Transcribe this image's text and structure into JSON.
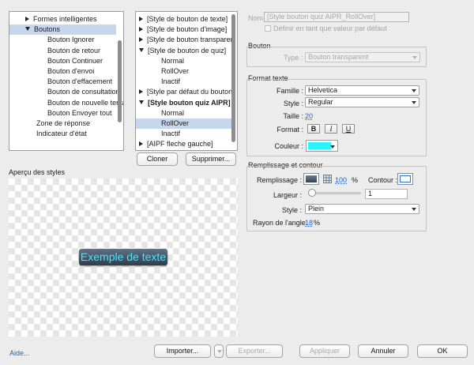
{
  "tree1": {
    "items": [
      {
        "label": "Formes intelligentes",
        "expander": "collapsed"
      },
      {
        "label": "Boutons",
        "expander": "expanded",
        "selected": true
      },
      {
        "label": "Bouton Ignorer"
      },
      {
        "label": "Bouton de retour"
      },
      {
        "label": "Bouton Continuer"
      },
      {
        "label": "Bouton d'envoi"
      },
      {
        "label": "Bouton d'effacement"
      },
      {
        "label": "Bouton de consultation"
      },
      {
        "label": "Bouton de nouvelle tentative"
      },
      {
        "label": "Bouton Envoyer tout"
      },
      {
        "label": "Zone de réponse"
      },
      {
        "label": "Indicateur d'état"
      }
    ]
  },
  "tree2": {
    "items": [
      {
        "label": "[Style de bouton de texte]",
        "expander": "collapsed"
      },
      {
        "label": "[Style de bouton d'image]",
        "expander": "collapsed"
      },
      {
        "label": "[Style de bouton transparent]",
        "expander": "collapsed"
      },
      {
        "label": "[Style de bouton de quiz]",
        "expander": "expanded"
      },
      {
        "label": "Normal"
      },
      {
        "label": "RollOver"
      },
      {
        "label": "Inactif"
      },
      {
        "label": "[Style par défaut du bouton]",
        "expander": "collapsed"
      },
      {
        "label": "[Style bouton quiz AIPR]",
        "expander": "expanded",
        "bold": true
      },
      {
        "label": "Normal"
      },
      {
        "label": "RollOver",
        "selected": true
      },
      {
        "label": "Inactif"
      },
      {
        "label": "[AIPF fleche gauche]",
        "expander": "collapsed"
      }
    ]
  },
  "buttons": {
    "clone": "Cloner",
    "delete": "Supprimer...",
    "help": "Aide...",
    "import": "Importer...",
    "export": "Exporter...",
    "apply": "Appliquer",
    "cancel": "Annuler",
    "ok": "OK"
  },
  "preview": {
    "label": "Aperçu des styles",
    "sample_text": "Exemple de texte"
  },
  "name": {
    "label": "Nom",
    "value": "[Style bouton quiz AIPR_RollOver]",
    "default_checkbox": "Définir en tant que valeur par défaut"
  },
  "button_group": {
    "title": "Bouton",
    "type_label": "Type :",
    "type_value": "Bouton transparent"
  },
  "text_format": {
    "title": "Format texte",
    "family_label": "Famille :",
    "family_value": "Helvetica",
    "style_label": "Style :",
    "style_value": "Regular",
    "size_label": "Taille :",
    "size_value": "20",
    "format_label": "Format :",
    "bold": "B",
    "italic": "I",
    "underline": "U",
    "color_label": "Couleur :",
    "color_value": "#29f4ff"
  },
  "fill_stroke": {
    "title": "Remplissage et contour",
    "fill_label": "Remplissage :",
    "fill_opacity": "100",
    "percent": "%",
    "stroke_label": "Contour :",
    "width_label": "Largeur :",
    "width_value": "1",
    "style_label": "Style :",
    "style_value": "Plein",
    "radius_label": "Rayon de l'angle",
    "radius_value": "18",
    "radius_unit": "%"
  },
  "colors": {
    "selection": "#c7d6ec",
    "accent_blue": "#2563b5",
    "sample_text": "#47e8ff"
  }
}
